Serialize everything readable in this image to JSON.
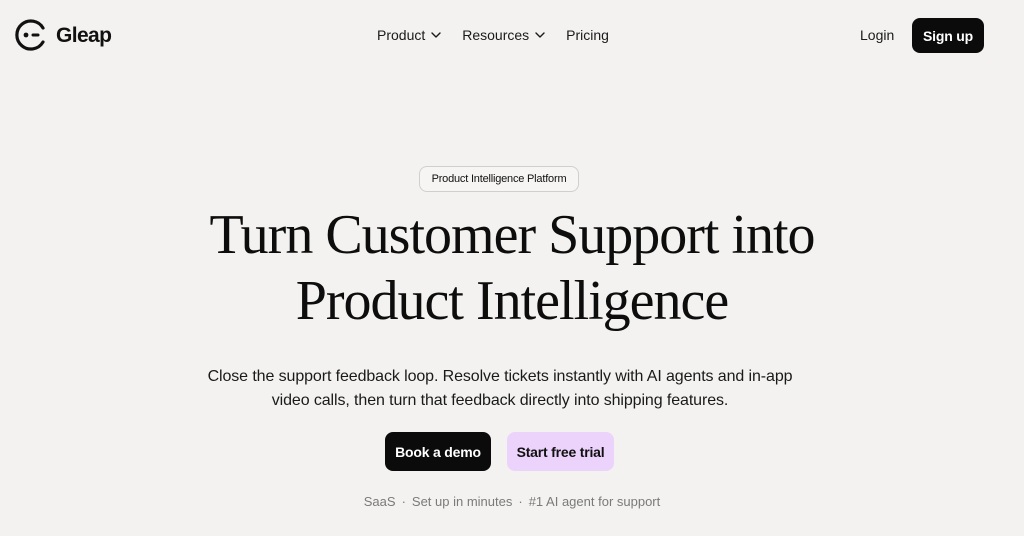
{
  "brand": {
    "name": "Gleap",
    "logo_icon": "gleap-smiley-logo-icon"
  },
  "nav": {
    "links": [
      {
        "label": "Product",
        "has_dropdown": true
      },
      {
        "label": "Resources",
        "has_dropdown": true
      },
      {
        "label": "Pricing",
        "has_dropdown": false
      }
    ],
    "login_label": "Login",
    "signup_label": "Sign up"
  },
  "hero": {
    "badge": "Product Intelligence Platform",
    "headline_line1": "Turn Customer Support into",
    "headline_line2": "Product Intelligence",
    "subheadline": "Close the support feedback loop. Resolve tickets instantly with AI agents and in-app video calls, then turn that feedback directly into shipping features.",
    "primary_cta": "Book a demo",
    "secondary_cta": "Start free trial",
    "meta": [
      "SaaS",
      "Set up in minutes",
      "#1 AI agent for support"
    ],
    "meta_separator": "·"
  },
  "colors": {
    "background": "#f3f2f0",
    "primary_button": "#0b0b0b",
    "secondary_button": "#ecd3fb",
    "muted_text": "#7a7a7a"
  }
}
